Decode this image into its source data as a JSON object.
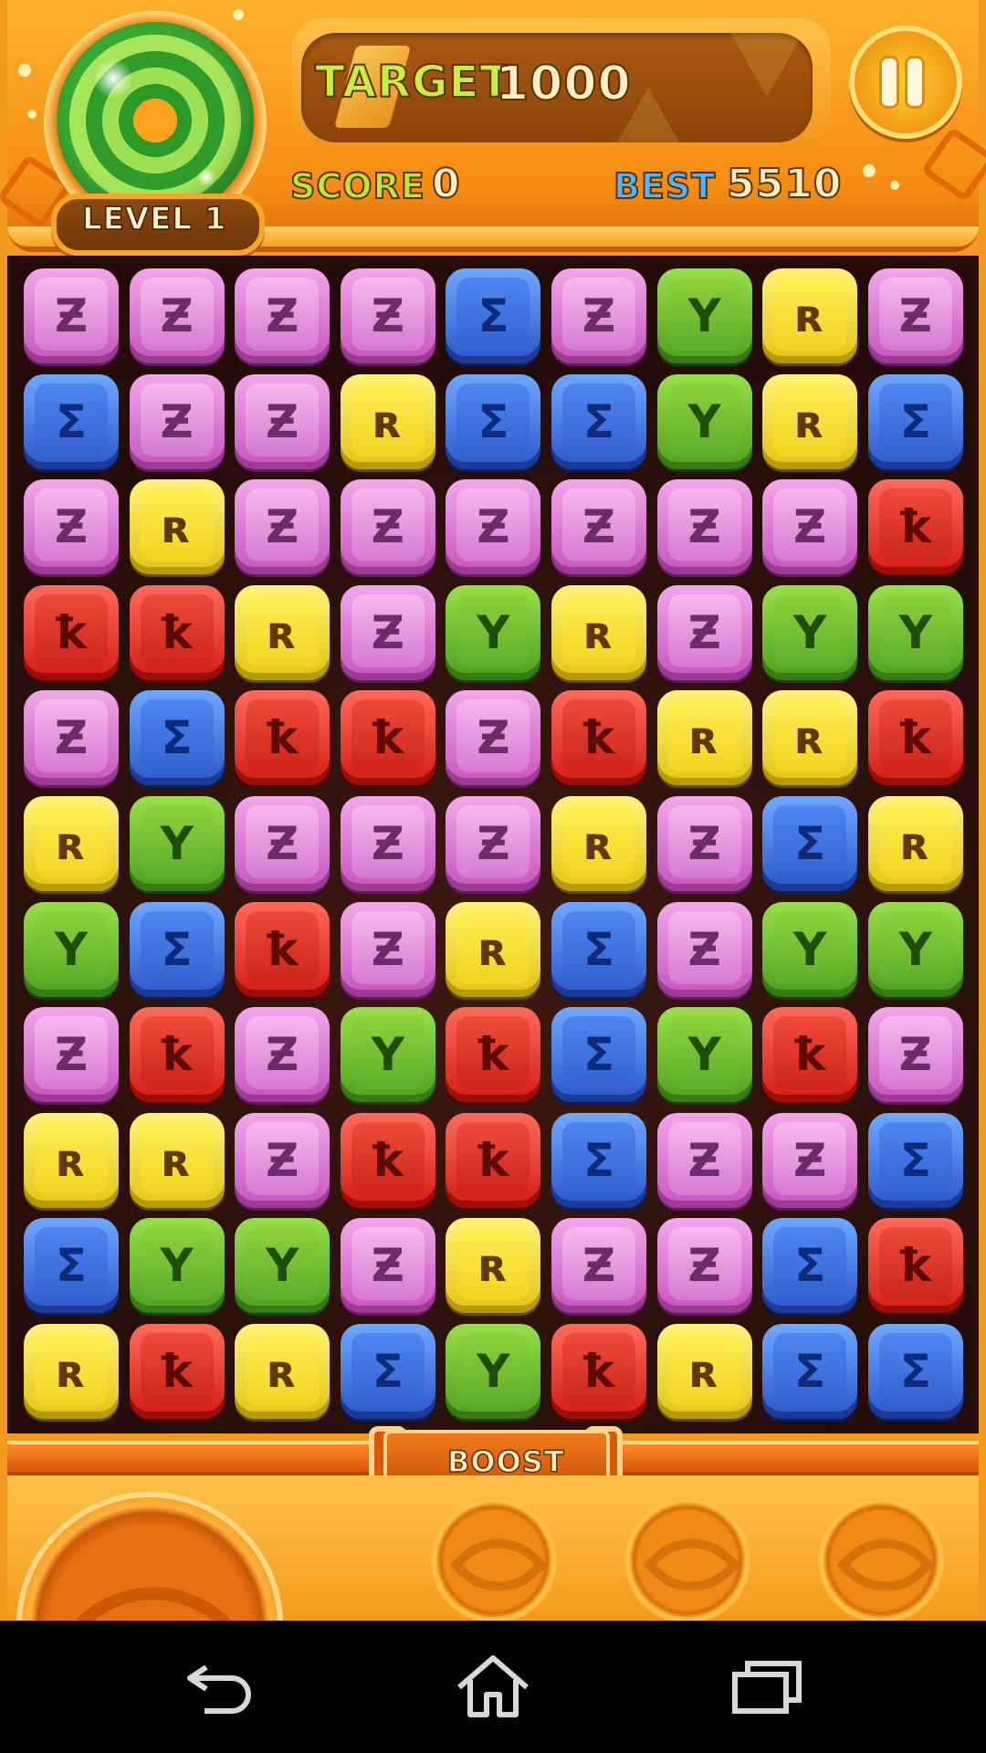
{
  "hud": {
    "target_label": "TARGET",
    "target_value": "1000",
    "score_label": "SCORE",
    "score_value": "0",
    "best_label": "BEST",
    "best_value": "5510",
    "level_label": "LEVEL 1"
  },
  "boost": {
    "label": "BOOST",
    "slots": 3
  },
  "board": {
    "rows": 11,
    "cols": 9,
    "glyphs": {
      "pink": "Ƶ",
      "blue": "Σ",
      "green": "Y",
      "yellow": "ʀ",
      "red": "ꝁ"
    },
    "colors": {
      "pink": "#d67ad0",
      "blue": "#3262d0",
      "green": "#5eae2a",
      "yellow": "#f0d420",
      "red": "#cc2418"
    },
    "grid": [
      [
        "pink",
        "pink",
        "pink",
        "pink",
        "blue",
        "pink",
        "green",
        "yellow",
        "pink"
      ],
      [
        "blue",
        "pink",
        "pink",
        "yellow",
        "blue",
        "blue",
        "green",
        "yellow",
        "blue"
      ],
      [
        "pink",
        "yellow",
        "pink",
        "pink",
        "pink",
        "pink",
        "pink",
        "pink",
        "red"
      ],
      [
        "red",
        "red",
        "yellow",
        "pink",
        "green",
        "yellow",
        "pink",
        "green",
        "green"
      ],
      [
        "pink",
        "blue",
        "red",
        "red",
        "pink",
        "red",
        "yellow",
        "yellow",
        "red"
      ],
      [
        "yellow",
        "green",
        "pink",
        "pink",
        "pink",
        "yellow",
        "pink",
        "blue",
        "yellow"
      ],
      [
        "green",
        "blue",
        "red",
        "pink",
        "yellow",
        "blue",
        "pink",
        "green",
        "green"
      ],
      [
        "pink",
        "red",
        "pink",
        "green",
        "red",
        "blue",
        "green",
        "red",
        "pink"
      ],
      [
        "yellow",
        "yellow",
        "pink",
        "red",
        "red",
        "blue",
        "pink",
        "pink",
        "blue"
      ],
      [
        "blue",
        "green",
        "green",
        "pink",
        "yellow",
        "pink",
        "pink",
        "blue",
        "red"
      ],
      [
        "yellow",
        "red",
        "yellow",
        "blue",
        "green",
        "red",
        "yellow",
        "blue",
        "blue"
      ]
    ]
  },
  "navbar": {
    "icons": [
      "back-icon",
      "home-icon",
      "recent-apps-icon"
    ]
  }
}
